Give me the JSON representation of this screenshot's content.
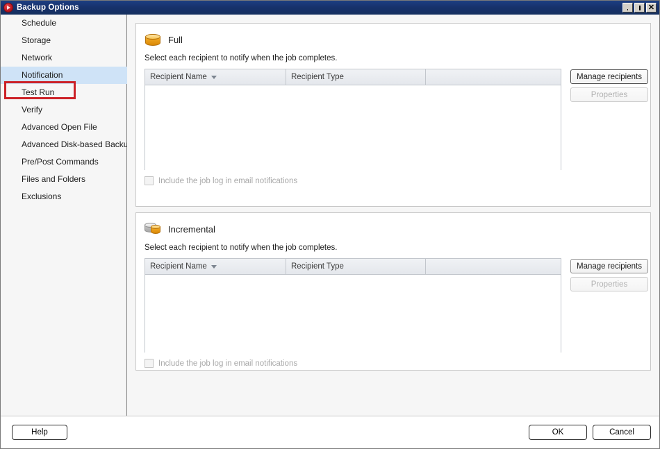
{
  "window": {
    "title": "Backup Options",
    "icon": "app-circle-play-icon",
    "controls": [
      {
        "name": "minimize",
        "glyph": "_"
      },
      {
        "name": "maximize",
        "glyph": "❐"
      },
      {
        "name": "close",
        "glyph": "✕"
      }
    ]
  },
  "sidebar": {
    "items": [
      {
        "label": "Schedule",
        "selected": false
      },
      {
        "label": "Storage",
        "selected": false
      },
      {
        "label": "Network",
        "selected": false
      },
      {
        "label": "Notification",
        "selected": true
      },
      {
        "label": "Test Run",
        "selected": false
      },
      {
        "label": "Verify",
        "selected": false
      },
      {
        "label": "Advanced Open File",
        "selected": false
      },
      {
        "label": "Advanced Disk-based Backup",
        "selected": false
      },
      {
        "label": "Pre/Post Commands",
        "selected": false
      },
      {
        "label": "Files and Folders",
        "selected": false
      },
      {
        "label": "Exclusions",
        "selected": false
      }
    ],
    "annotation_color": "#cc2127"
  },
  "sections": {
    "full": {
      "title": "Full",
      "icon": "orange-database-cylinder-icon",
      "description": "Select each recipient to notify when the job completes.",
      "table": {
        "columns": [
          {
            "label": "Recipient Name",
            "sort": "descending"
          },
          {
            "label": "Recipient Type",
            "sort": "none"
          },
          {
            "label": "",
            "sort": "none"
          }
        ],
        "rows": []
      },
      "manage_button": "Manage recipients",
      "properties_button": "Properties",
      "properties_disabled": true,
      "checkbox_label": "Include the job log in email notifications",
      "checkbox_checked": false
    },
    "incremental": {
      "title": "Incremental",
      "icon": "gray-orange-database-cylinder-icon",
      "description": "Select each recipient to notify when the job completes.",
      "table": {
        "columns": [
          {
            "label": "Recipient Name",
            "sort": "descending"
          },
          {
            "label": "Recipient Type",
            "sort": "none"
          },
          {
            "label": "",
            "sort": "none"
          }
        ],
        "rows": []
      },
      "manage_button": "Manage recipients",
      "properties_button": "Properties",
      "properties_disabled": true,
      "checkbox_label": "Include the job log in email notifications",
      "checkbox_checked": false
    }
  },
  "footer": {
    "help": "Help",
    "ok": "OK",
    "cancel": "Cancel"
  },
  "colors": {
    "titlebar": "#17316b",
    "selection": "#cfe3f7",
    "annotation": "#cc2127",
    "accent_orange": "#eda21d"
  }
}
